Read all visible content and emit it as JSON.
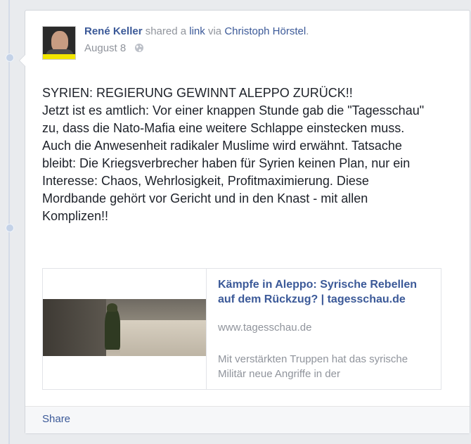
{
  "post": {
    "author": "René Keller",
    "shared_a": "shared a",
    "link_word": "link",
    "via": "via",
    "via_name": "Christoph Hörstel",
    "period": ".",
    "date": "August 8",
    "privacy_icon": "globe-icon",
    "message_lines": [
      "SYRIEN: REGIERUNG GEWINNT ALEPPO ZURÜCK!!",
      "Jetzt ist es amtlich: Vor einer knappen Stunde gab die \"Tagesschau\" zu, dass die Nato-Mafia eine weitere Schlappe einstecken muss. Auch die Anwesenheit radikaler Muslime wird erwähnt. Tatsache bleibt: Die Kriegsverbrecher haben für Syrien keinen Plan, nur ein Interesse: Chaos, Wehrlosigkeit, Profitmaximierung. Diese Mordbande gehört vor Gericht und in den Knast - mit allen Komplizen!!"
    ]
  },
  "link_preview": {
    "title": "Kämpfe in Aleppo: Syrische Rebellen auf dem Rückzug? | tagesschau.de",
    "domain": "www.tagesschau.de",
    "description": "Mit verstärkten Truppen hat das syrische Militär neue Angriffe in der"
  },
  "footer": {
    "share_label": "Share"
  },
  "colors": {
    "link_blue": "#3b5998",
    "muted_gray": "#90949c",
    "text": "#1d2129"
  }
}
